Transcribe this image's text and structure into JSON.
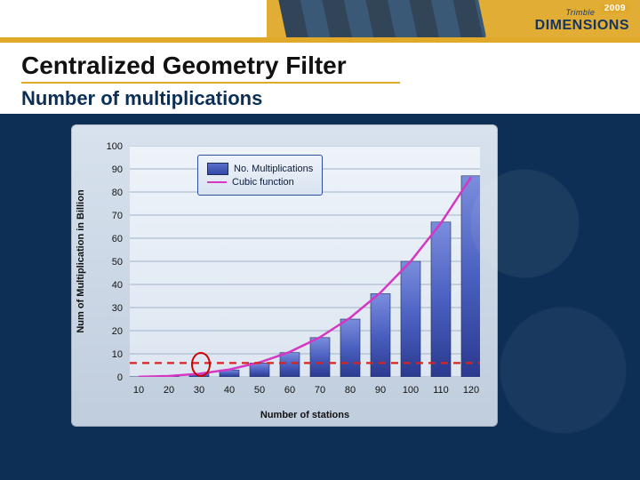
{
  "brand": {
    "company": "Trimble",
    "product": "DIMENSIONS",
    "year": "2009"
  },
  "title": "Centralized Geometry Filter",
  "subtitle": "Number of multiplications",
  "legend": {
    "bar": "No. Multiplications",
    "line": "Cubic function"
  },
  "axes": {
    "xlabel": "Number of stations",
    "ylabel": "Num of Multiplication in Billion"
  },
  "chart_data": {
    "type": "bar",
    "title": "",
    "xlabel": "Number of stations",
    "ylabel": "Num of Multiplication in Billion",
    "xlim": [
      10,
      120
    ],
    "ylim": [
      0,
      100
    ],
    "xticks": [
      10,
      20,
      30,
      40,
      50,
      60,
      70,
      80,
      90,
      100,
      110,
      120
    ],
    "yticks": [
      0,
      10,
      20,
      30,
      40,
      50,
      60,
      70,
      80,
      90,
      100
    ],
    "categories": [
      10,
      20,
      30,
      40,
      50,
      60,
      70,
      80,
      90,
      100,
      110,
      120
    ],
    "series": [
      {
        "name": "No. Multiplications",
        "type": "bar",
        "values": [
          0.05,
          0.4,
          1.3,
          3.0,
          6.0,
          10.5,
          17,
          25,
          36,
          50,
          67,
          87
        ]
      },
      {
        "name": "Cubic function",
        "type": "line",
        "values": [
          0.05,
          0.4,
          1.35,
          3.2,
          6.25,
          10.8,
          17.15,
          25.6,
          36.45,
          50,
          66.55,
          86.4
        ]
      }
    ],
    "annotations": {
      "dashed_hline_y": 6
    }
  }
}
